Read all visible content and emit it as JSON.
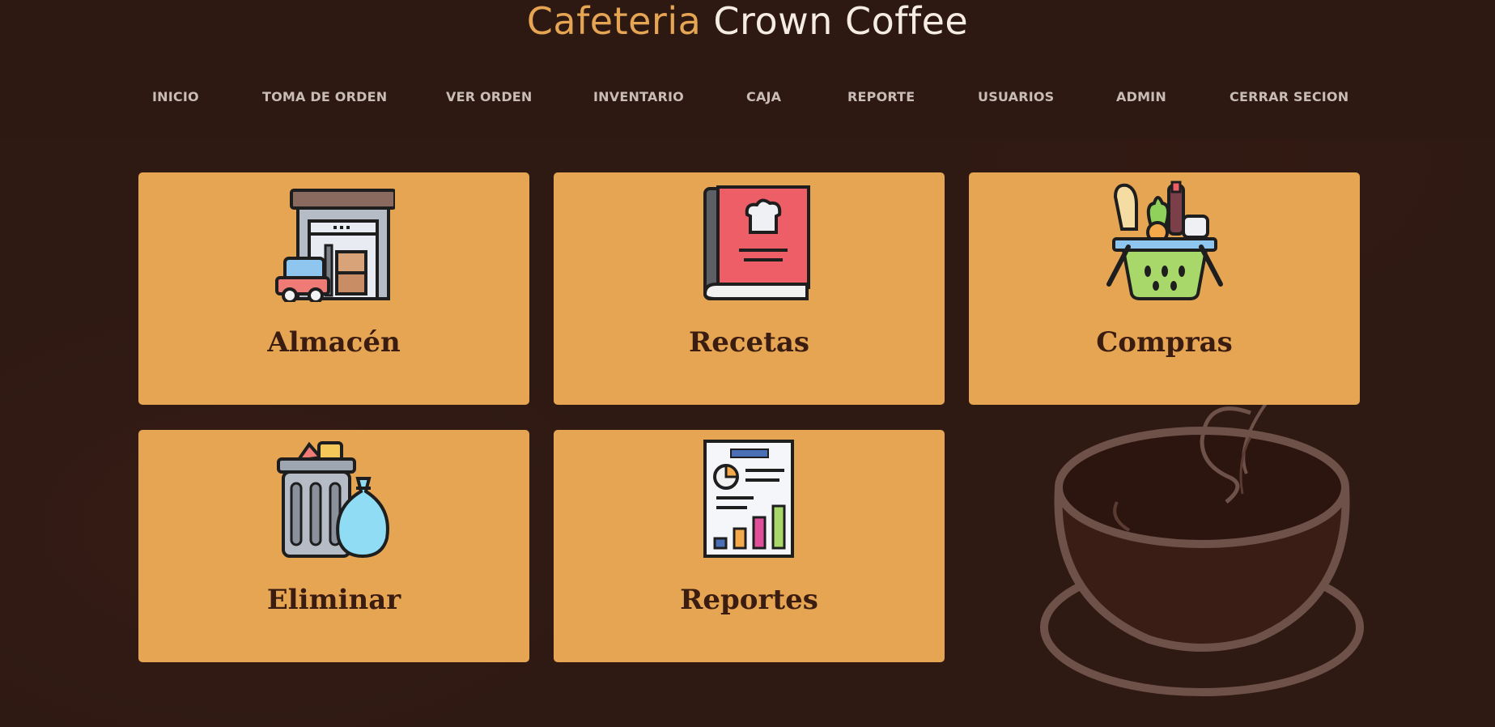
{
  "header": {
    "brand_accent": "Cafeteria",
    "brand_rest": " Crown Coffee",
    "accent_color": "#e5a553"
  },
  "nav": {
    "items": [
      {
        "label": "INICIO"
      },
      {
        "label": "TOMA DE ORDEN"
      },
      {
        "label": "VER ORDEN"
      },
      {
        "label": "INVENTARIO"
      },
      {
        "label": "CAJA"
      },
      {
        "label": "REPORTE"
      },
      {
        "label": "USUARIOS"
      },
      {
        "label": "ADMIN"
      },
      {
        "label": "CERRAR SECION"
      }
    ]
  },
  "cards": [
    {
      "label": "Almacén",
      "icon": "warehouse-icon"
    },
    {
      "label": "Recetas",
      "icon": "recipe-book-icon"
    },
    {
      "label": "Compras",
      "icon": "shopping-basket-icon"
    },
    {
      "label": "Eliminar",
      "icon": "trash-can-icon"
    },
    {
      "label": "Reportes",
      "icon": "report-icon"
    }
  ],
  "colors": {
    "background": "#2f1913",
    "card": "#e5a553",
    "card_text": "#3b1c10",
    "nav_text": "#c9bcb6"
  }
}
